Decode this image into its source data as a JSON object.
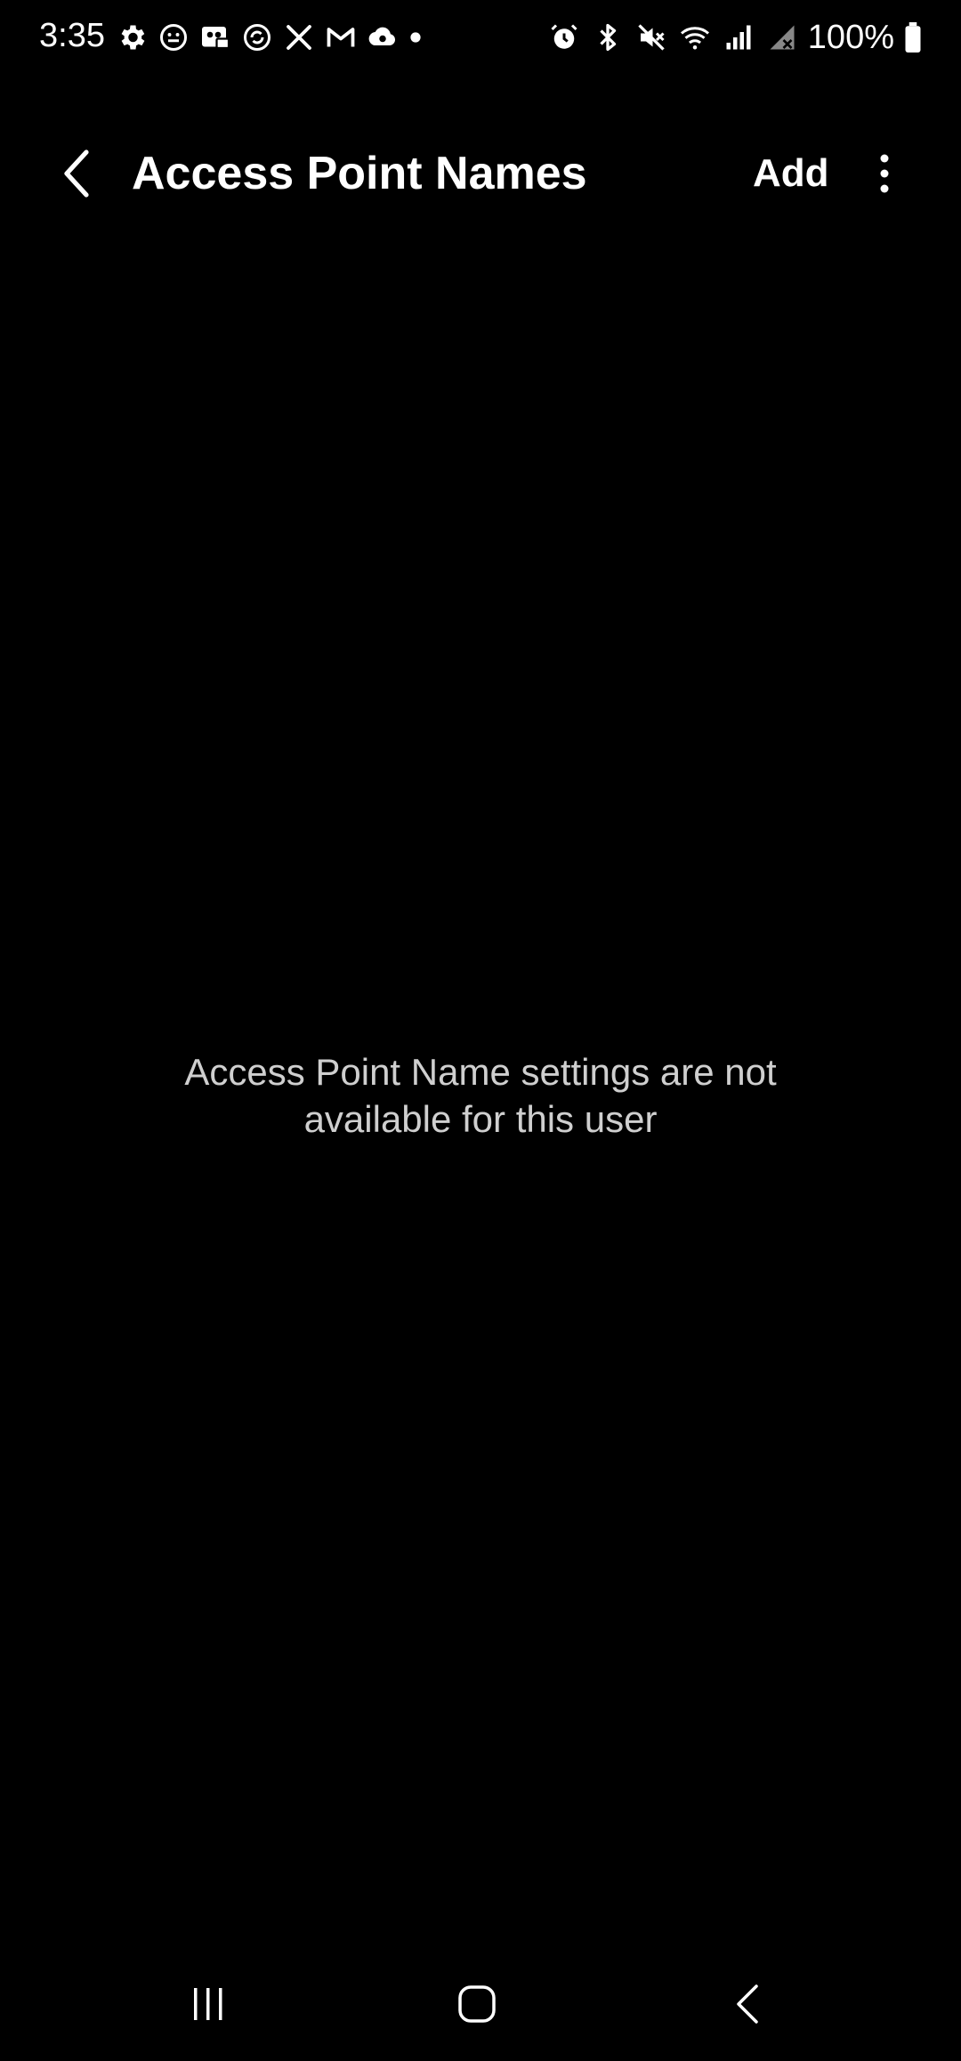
{
  "status_bar": {
    "time": "3:35",
    "battery_percent": "100%",
    "left_icons": [
      "settings-icon",
      "face-emoji-icon",
      "voicemail-icon",
      "sync-icon",
      "tools-icon",
      "gmail-icon",
      "cloud-icon",
      "dot-icon"
    ],
    "right_icons": [
      "alarm-icon",
      "bluetooth-icon",
      "mute-icon",
      "wifi-icon",
      "signal-icon",
      "no-signal-icon",
      "battery-icon"
    ]
  },
  "app_bar": {
    "title": "Access Point Names",
    "add_label": "Add",
    "back_icon": "chevron-left-icon",
    "more_icon": "more-vertical-icon"
  },
  "main": {
    "message": "Access Point Name settings are not available for this user"
  },
  "nav_bar": {
    "recents_icon": "recents-icon",
    "home_icon": "home-icon",
    "back_icon": "back-icon"
  },
  "colors": {
    "background": "#000000",
    "text_primary": "#ffffff",
    "text_secondary": "#cfcfcf"
  }
}
